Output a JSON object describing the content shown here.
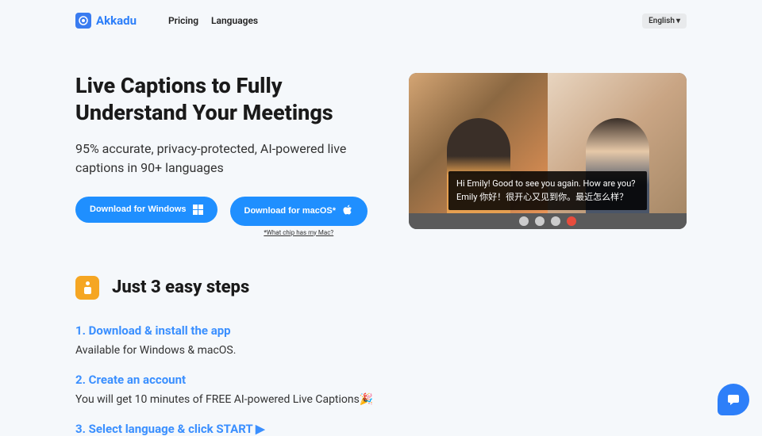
{
  "header": {
    "logo_text": "Akkadu",
    "nav": {
      "pricing": "Pricing",
      "languages": "Languages"
    },
    "lang_selector": "English"
  },
  "hero": {
    "headline": "Live Captions to Fully Understand Your Meetings",
    "subheadline": "95% accurate, privacy-protected, AI-powered live captions in 90+ languages",
    "btn_windows": "Download for Windows",
    "btn_mac": "Download for macOS*",
    "chip_link": "*What chip has my Mac?",
    "caption_line1": "Hi Emily! Good to see you again. How are you?",
    "caption_line2": "Emily 你好！很开心又见到你。最近怎么样？"
  },
  "steps": {
    "title": "Just 3 easy steps",
    "items": [
      {
        "title": "1. Download & install the app",
        "desc": "Available for Windows & macOS."
      },
      {
        "title": "2. Create an account",
        "desc": "You will get 10 minutes of FREE AI-powered Live Captions🎉"
      },
      {
        "title": "3. Select language & click START ▶"
      }
    ]
  }
}
